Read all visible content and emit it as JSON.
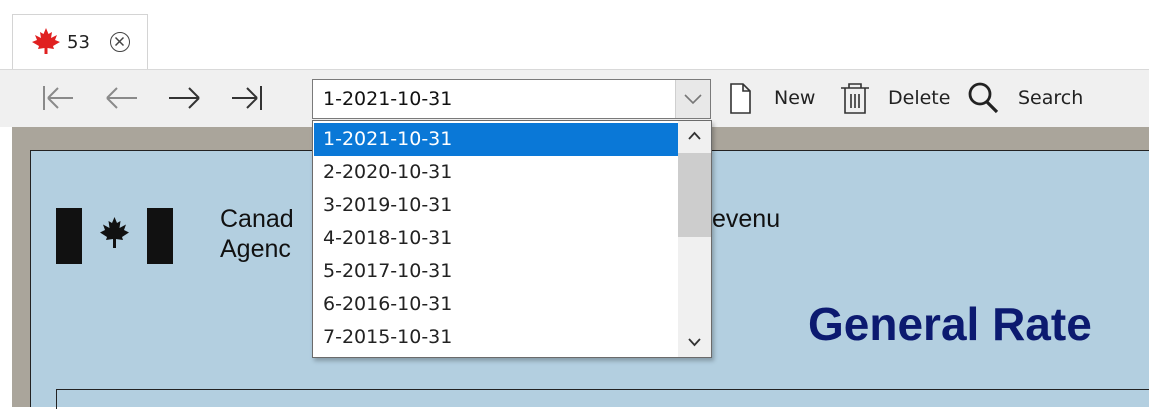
{
  "tab": {
    "label": "53",
    "icon": "maple-leaf-icon",
    "close_icon": "close-circle-icon",
    "leaf_color": "#e02020"
  },
  "toolbar": {
    "nav_buttons": [
      "first-icon",
      "previous-icon",
      "next-icon",
      "last-icon"
    ],
    "record_select": {
      "value": "1-2021-10-31"
    },
    "new_label": "New",
    "delete_label": "Delete",
    "search_label": "Search"
  },
  "dropdown": {
    "options": [
      "1-2021-10-31",
      "2-2020-10-31",
      "3-2019-10-31",
      "4-2018-10-31",
      "5-2017-10-31",
      "6-2016-10-31",
      "7-2015-10-31"
    ],
    "selected_index": 0,
    "selected_color": "#0a78d7"
  },
  "document": {
    "agency_line1": "Canad",
    "agency_line2": "Agenc",
    "agency_line1_tail": "evenu",
    "heading": "General Rate",
    "page_color": "#b3cfe0",
    "heading_color": "#0c1a70"
  }
}
